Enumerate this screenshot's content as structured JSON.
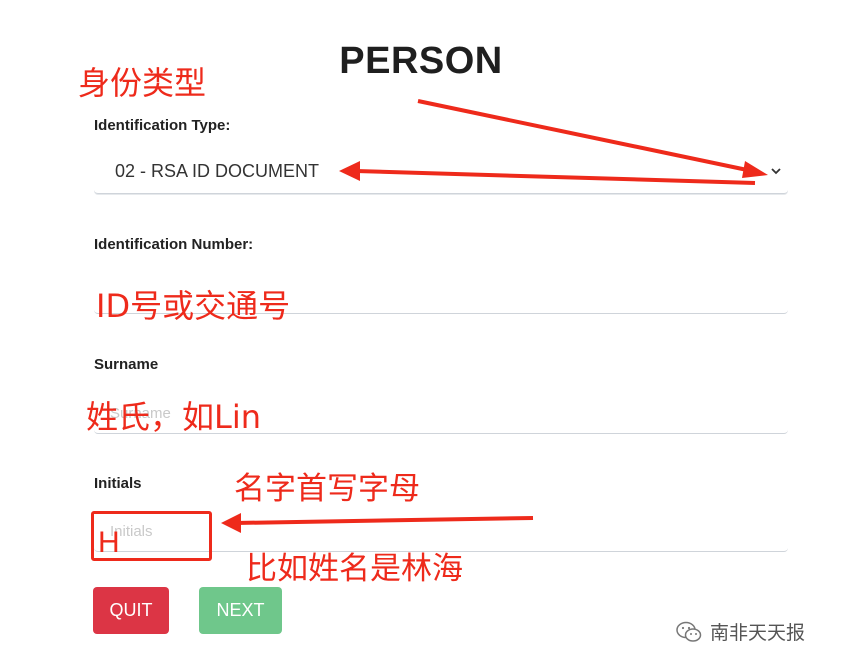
{
  "page": {
    "title": "PERSON"
  },
  "form": {
    "id_type": {
      "label": "Identification Type:",
      "value": "02 - RSA ID DOCUMENT"
    },
    "id_number": {
      "label": "Identification Number:",
      "value": ""
    },
    "surname": {
      "label": "Surname",
      "placeholder": "Surname",
      "value": ""
    },
    "initials": {
      "label": "Initials",
      "placeholder": "Initials",
      "value": ""
    }
  },
  "buttons": {
    "quit": "QUIT",
    "next": "NEXT"
  },
  "annotations": {
    "id_type_note": "身份类型",
    "id_number_note": "ID号或交通号",
    "surname_note": "姓氏，如Lin",
    "initials_note": "名字首写字母",
    "initials_example": "比如姓名是林海",
    "initials_value_note": "H",
    "color": "#ee2a1b"
  },
  "watermark": {
    "text": "南非天天报",
    "icon": "wechat-icon"
  }
}
